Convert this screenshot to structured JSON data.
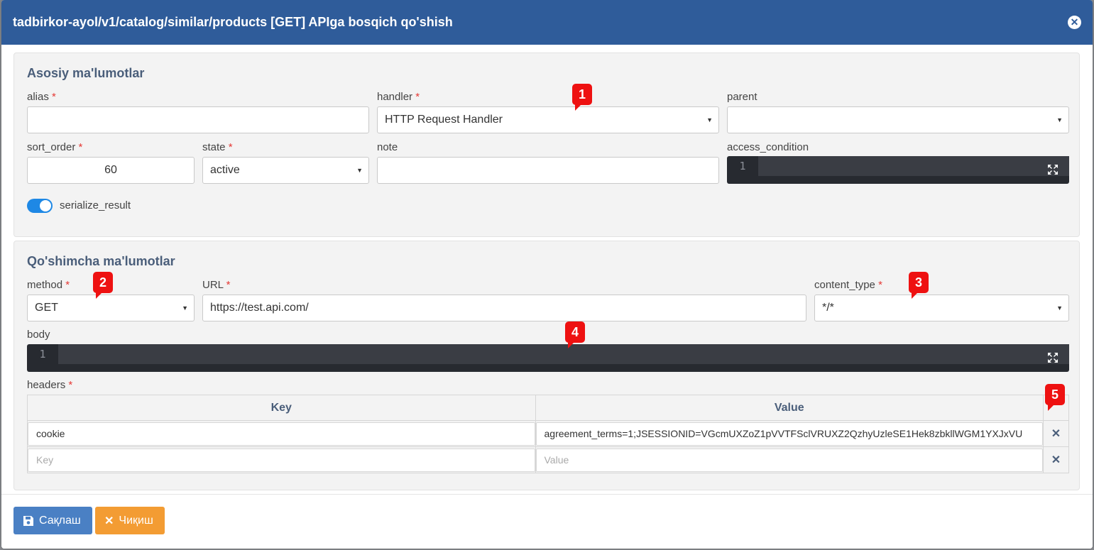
{
  "modal": {
    "title": "tadbirkor-ayol/v1/catalog/similar/products [GET] APIga bosqich qo'shish",
    "close_icon": "close-icon"
  },
  "main_section": {
    "title": "Asosiy ma'lumotlar",
    "alias": {
      "label": "alias",
      "required": "*",
      "value": ""
    },
    "handler": {
      "label": "handler",
      "required": "*",
      "value": "HTTP Request Handler"
    },
    "parent": {
      "label": "parent",
      "value": ""
    },
    "sort_order": {
      "label": "sort_order",
      "required": "*",
      "value": "60"
    },
    "state": {
      "label": "state",
      "required": "*",
      "value": "active"
    },
    "note": {
      "label": "note",
      "value": ""
    },
    "access_condition": {
      "label": "access_condition",
      "line_no": "1"
    },
    "serialize_result": {
      "label": "serialize_result",
      "enabled": true
    }
  },
  "extra_section": {
    "title": "Qo'shimcha ma'lumotlar",
    "method": {
      "label": "method",
      "required": "*",
      "value": "GET"
    },
    "url": {
      "label": "URL",
      "required": "*",
      "value": "https://test.api.com/"
    },
    "content_type": {
      "label": "content_type",
      "required": "*",
      "value": "*/*"
    },
    "body": {
      "label": "body",
      "line_no": "1"
    },
    "headers": {
      "label": "headers",
      "required": "*",
      "columns": [
        "Key",
        "Value"
      ],
      "rows": [
        {
          "key": "cookie",
          "value": "agreement_terms=1;JSESSIONID=VGcmUXZoZ1pVVTFSclVRUXZ2QzhyUzleSE1Hek8zbkllWGM1YXJxVU"
        }
      ],
      "new_row": {
        "key_placeholder": "Key",
        "value_placeholder": "Value"
      }
    }
  },
  "badges": [
    "1",
    "2",
    "3",
    "4",
    "5"
  ],
  "footer": {
    "save_label": "Сақлаш",
    "exit_label": "Чиқиш"
  },
  "colors": {
    "header": "#2f5c9a",
    "save": "#4a80c4",
    "exit": "#f39c33",
    "badge": "#ee1111",
    "toggle": "#1e88e5"
  }
}
